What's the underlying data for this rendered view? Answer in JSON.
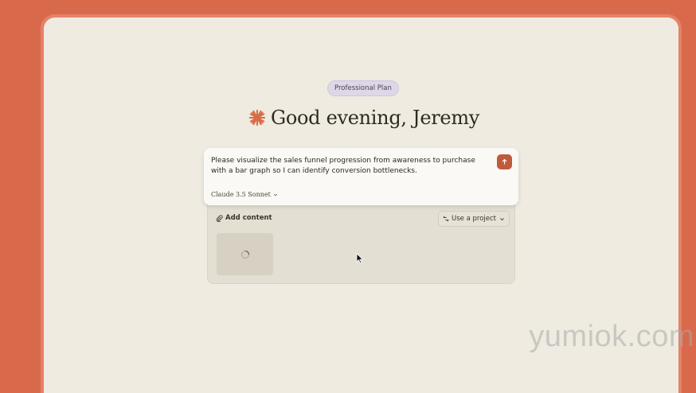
{
  "plan_badge": "Professional Plan",
  "greeting": "Good evening, Jeremy",
  "composer": {
    "text": "Please visualize the sales funnel progression from awareness to purchase with a bar graph so I can identify conversion bottlenecks.",
    "model": "Claude 3.5 Sonnet"
  },
  "attachments": {
    "add_content_label": "Add content",
    "use_project_label": "Use a project"
  },
  "watermark": "yumiok.com",
  "colors": {
    "background": "#d9694b",
    "frame": "#efebe1",
    "accent": "#bf5a3a",
    "spark": "#d86c45"
  },
  "icons": [
    "spark-icon",
    "send-arrow-icon",
    "chevron-down-icon",
    "paperclip-icon",
    "project-icon",
    "spinner-icon",
    "cursor-icon"
  ]
}
